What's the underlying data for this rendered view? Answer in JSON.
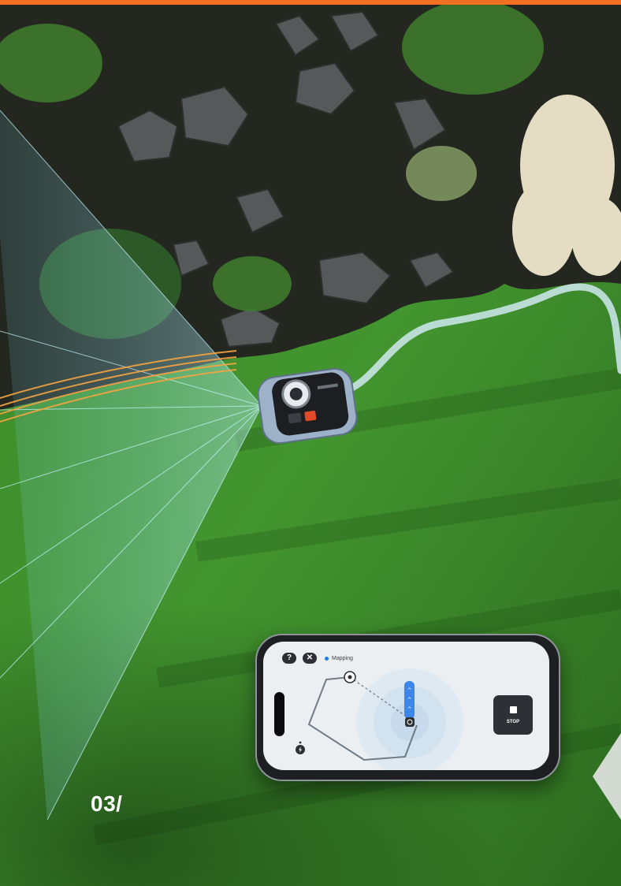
{
  "page": {
    "slide_number": "03/"
  },
  "app": {
    "mapping_status": "Mapping",
    "stop_label": "STOP",
    "help_glyph": "?",
    "close_glyph": "✕"
  },
  "icons": {
    "help": "question-mark-icon",
    "close": "close-icon",
    "stop": "stop-square-icon",
    "charging_station": "charging-station-icon",
    "next": "chevron-left-arrow-icon"
  },
  "colors": {
    "accent": "#f36f21",
    "lawn": "#3d8a2b",
    "status_dot": "#1f7bff",
    "sensor_beam": "#8fe8ff"
  }
}
